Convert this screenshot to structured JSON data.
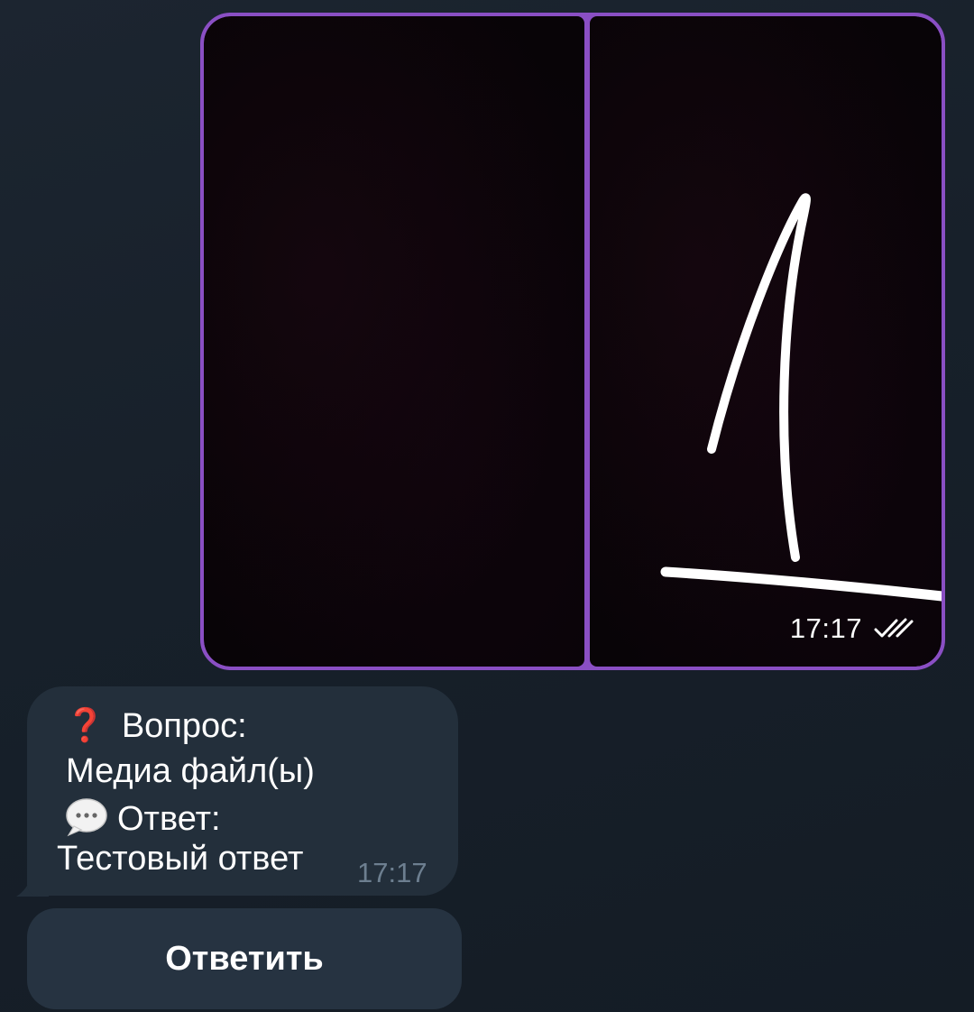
{
  "album": {
    "time": "17:17",
    "status_icon": "double-check-icon",
    "accent_color": "#8a4fc4"
  },
  "message": {
    "question_icon": "❓",
    "question_label": "Вопрос:",
    "question_text": "Медиа файл(ы)",
    "answer_icon": "speech-bubble-icon",
    "answer_label": "Ответ:",
    "answer_text": "Тестовый ответ",
    "time": "17:17"
  },
  "keyboard": {
    "reply_label": "Ответить"
  }
}
